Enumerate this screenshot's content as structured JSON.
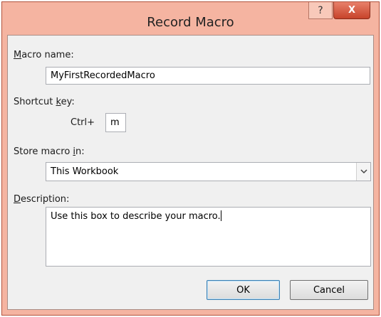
{
  "dialog": {
    "title": "Record Macro",
    "help_glyph": "?",
    "close_glyph": "X"
  },
  "macro_name": {
    "label_access": "M",
    "label_rest": "acro name:",
    "value": "MyFirstRecordedMacro"
  },
  "shortcut": {
    "label_pre": "Shortcut ",
    "label_access": "k",
    "label_post": "ey:",
    "prefix": "Ctrl+",
    "value": "m"
  },
  "store": {
    "label_pre": "Store macro ",
    "label_access": "i",
    "label_post": "n:",
    "selected": "This Workbook"
  },
  "description": {
    "label_access": "D",
    "label_rest": "escription:",
    "value": "Use this box to describe your macro."
  },
  "buttons": {
    "ok": "OK",
    "cancel": "Cancel"
  },
  "icons": {
    "help": "help-icon",
    "close": "close-icon",
    "dropdown": "chevron-down-icon"
  }
}
